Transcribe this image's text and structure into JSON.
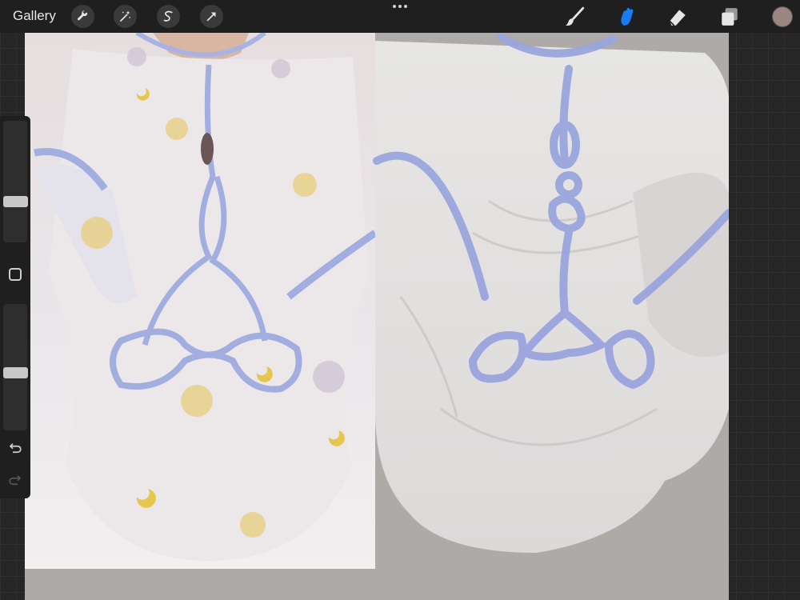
{
  "topbar": {
    "gallery_label": "Gallery",
    "left_tools": [
      "wrench-icon",
      "magic-wand-icon",
      "selection-s-icon",
      "transform-arrow-icon"
    ],
    "right_tools": [
      "brush-icon",
      "smudge-icon",
      "eraser-icon",
      "layers-icon"
    ],
    "active_tool": "smudge-icon",
    "active_color": "#1a7cf5",
    "icon_color": "#e6e6e6",
    "current_color": "#9b8680"
  },
  "sidebar": {
    "brush_size": 0.68,
    "brush_opacity": 0.55,
    "icons": [
      "modify-square-icon",
      "undo-icon",
      "redo-icon"
    ]
  },
  "canvas": {
    "background": "#adaaa8",
    "sketch_line_color": "#9aa5dd"
  }
}
